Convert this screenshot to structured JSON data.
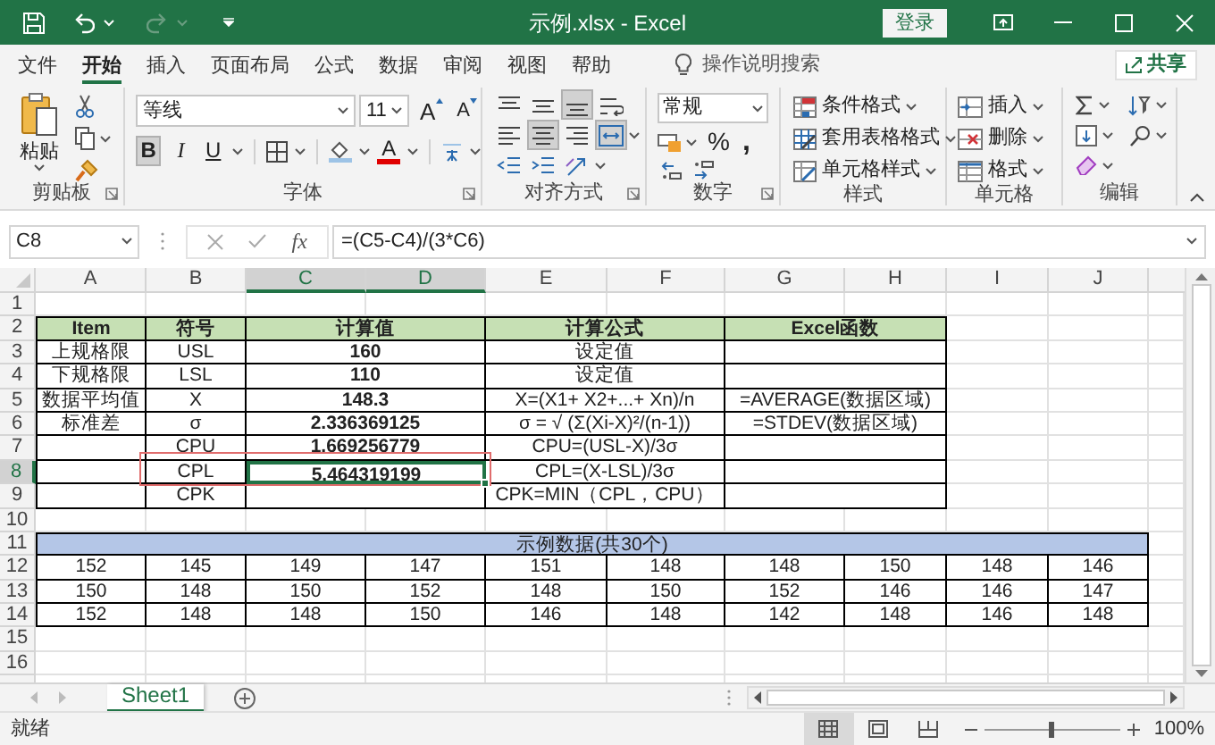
{
  "window": {
    "title": "示例.xlsx - Excel",
    "sign_in": "登录"
  },
  "ribbon_tabs": [
    {
      "label": "文件",
      "selected": false
    },
    {
      "label": "开始",
      "selected": true
    },
    {
      "label": "插入",
      "selected": false
    },
    {
      "label": "页面布局",
      "selected": false
    },
    {
      "label": "公式",
      "selected": false
    },
    {
      "label": "数据",
      "selected": false
    },
    {
      "label": "审阅",
      "selected": false
    },
    {
      "label": "视图",
      "selected": false
    },
    {
      "label": "帮助",
      "selected": false
    }
  ],
  "tell_me": "操作说明搜索",
  "share": "共享",
  "ribbon": {
    "clipboard": {
      "label": "剪贴板",
      "paste": "粘贴"
    },
    "font": {
      "label": "字体",
      "font_name": "等线",
      "font_size": "11",
      "grow": "A",
      "shrink": "A",
      "font_color": "A",
      "styles": [
        {
          "label": "B",
          "selected": true
        },
        {
          "label": "I",
          "selected": false
        },
        {
          "label": "U",
          "selected": false
        }
      ]
    },
    "alignment": {
      "label": "对齐方式",
      "buttons": [
        {
          "kind": "top",
          "selected": false
        },
        {
          "kind": "middle",
          "selected": false
        },
        {
          "kind": "bottom",
          "selected": true
        },
        {
          "kind": "wrap",
          "selected": false
        },
        {
          "kind": "left",
          "selected": false
        },
        {
          "kind": "center",
          "selected": true
        },
        {
          "kind": "right",
          "selected": false
        },
        {
          "kind": "merge",
          "selected": true
        },
        {
          "kind": "outdent",
          "selected": false
        },
        {
          "kind": "indent",
          "selected": false
        },
        {
          "kind": "orient",
          "selected": false
        }
      ]
    },
    "number": {
      "label": "数字",
      "format": "常规",
      "percent": "%",
      "comma": ","
    },
    "styles": {
      "label": "样式",
      "items": [
        "条件格式",
        "套用表格格式",
        "单元格样式"
      ]
    },
    "cells": {
      "label": "单元格",
      "items": [
        "插入",
        "删除",
        "格式"
      ]
    },
    "editing": {
      "label": "编辑"
    }
  },
  "formula_bar": {
    "name_box": "C8",
    "function_button": "fx",
    "formula": "=(C5-C4)/(3*C6)"
  },
  "column_headers": [
    {
      "label": "A",
      "selected": false
    },
    {
      "label": "B",
      "selected": false
    },
    {
      "label": "C",
      "selected": true
    },
    {
      "label": "D",
      "selected": true
    },
    {
      "label": "E",
      "selected": false
    },
    {
      "label": "F",
      "selected": false
    },
    {
      "label": "G",
      "selected": false
    },
    {
      "label": "H",
      "selected": false
    },
    {
      "label": "I",
      "selected": false
    },
    {
      "label": "J",
      "selected": false
    }
  ],
  "row_numbers": [
    {
      "label": "1",
      "selected": false
    },
    {
      "label": "2",
      "selected": false
    },
    {
      "label": "3",
      "selected": false
    },
    {
      "label": "4",
      "selected": false
    },
    {
      "label": "5",
      "selected": false
    },
    {
      "label": "6",
      "selected": false
    },
    {
      "label": "7",
      "selected": false
    },
    {
      "label": "8",
      "selected": true
    },
    {
      "label": "9",
      "selected": false
    },
    {
      "label": "10",
      "selected": false
    },
    {
      "label": "11",
      "selected": false
    },
    {
      "label": "12",
      "selected": false
    },
    {
      "label": "13",
      "selected": false
    },
    {
      "label": "14",
      "selected": false
    },
    {
      "label": "15",
      "selected": false
    },
    {
      "label": "16",
      "selected": false
    }
  ],
  "spec_table": {
    "header": {
      "item": "Item",
      "symbol": "符号",
      "value": "计算值",
      "formula": "计算公式",
      "function": "Excel函数"
    },
    "rows": [
      {
        "item": "上规格限",
        "symbol": "USL",
        "value": "160",
        "formula": "设定值",
        "selected": false
      },
      {
        "item": "下规格限",
        "symbol": "LSL",
        "value": "110",
        "formula": "设定值",
        "selected": false
      },
      {
        "item": "数据平均值",
        "symbol": "X",
        "value": "148.3",
        "formula": "X=(X1+ X2+...+ Xn)/n",
        "function": "=AVERAGE(数据区域)",
        "selected": false
      },
      {
        "item": "标准差",
        "symbol": "σ",
        "value": "2.336369125",
        "formula": "σ = √ (Σ(Xi-X)²/(n-1))",
        "function": "=STDEV(数据区域)",
        "selected": false
      },
      {
        "symbol": "CPU",
        "value": "1.669256779",
        "formula": "CPU=(USL-X)/3σ",
        "selected": false
      },
      {
        "symbol": "CPL",
        "value": "5.464319199",
        "formula": "CPL=(X-LSL)/3σ",
        "selected": true
      },
      {
        "symbol": "CPK",
        "formula": "CPK=MIN（CPL，CPU）",
        "selected": false
      }
    ]
  },
  "sample_table": {
    "title": "示例数据(共30个)",
    "rows": [
      [
        "152",
        "145",
        "149",
        "147",
        "151",
        "148",
        "148",
        "150",
        "148",
        "146"
      ],
      [
        "150",
        "148",
        "150",
        "152",
        "148",
        "150",
        "152",
        "146",
        "146",
        "147"
      ],
      [
        "152",
        "148",
        "148",
        "150",
        "146",
        "148",
        "142",
        "148",
        "146",
        "148"
      ]
    ]
  },
  "sheet_tabs": [
    {
      "label": "Sheet1",
      "selected": true
    }
  ],
  "status_bar": {
    "status": "就绪",
    "zoom": {
      "text": "100%",
      "level": 0.5
    }
  }
}
